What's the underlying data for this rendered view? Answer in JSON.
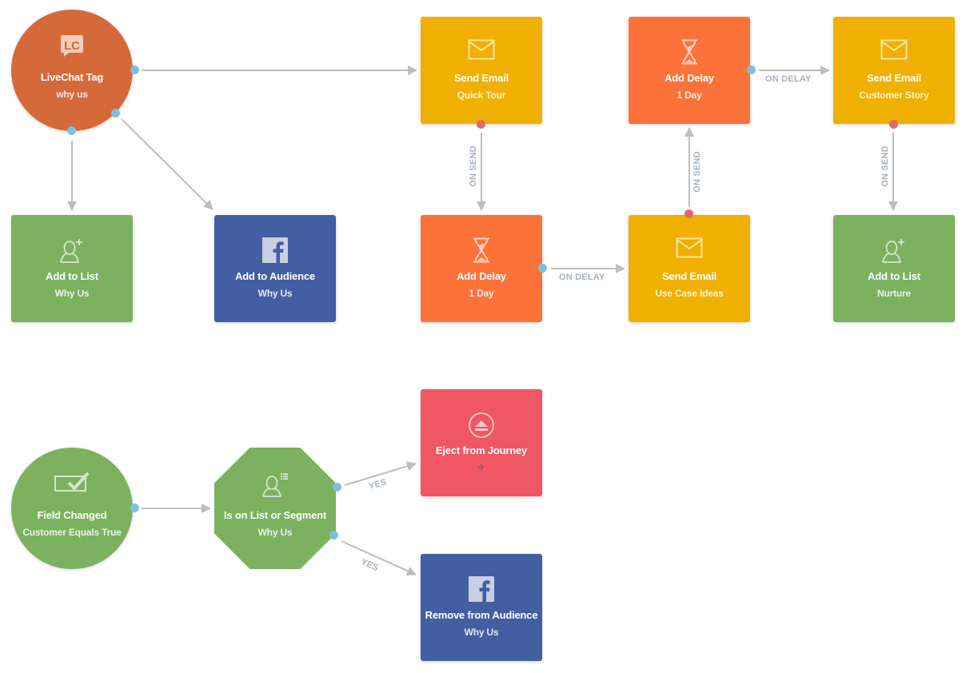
{
  "colors": {
    "livechat": "#d4693a",
    "email": "#f0b000",
    "delay": "#fd7238",
    "list": "#7bb15f",
    "facebook": "#435ea1",
    "eject": "#ef5862",
    "edge": "#bdbdbd",
    "edge_label": "#a7b1bf",
    "port_out": "#7ec0dc",
    "port_send": "#e06a6a"
  },
  "nodes": {
    "livechat_tag": {
      "title": "LiveChat Tag",
      "subtitle": "why us",
      "icon": "livechat-logo-icon"
    },
    "send_email_quick_tour": {
      "title": "Send Email",
      "subtitle": "Quick Tour",
      "icon": "envelope-icon"
    },
    "add_delay_top": {
      "title": "Add Delay",
      "subtitle": "1 Day",
      "icon": "hourglass-icon"
    },
    "send_email_customer_story": {
      "title": "Send Email",
      "subtitle": "Customer Story",
      "icon": "envelope-icon"
    },
    "add_to_list_why_us": {
      "title": "Add to List",
      "subtitle": "Why Us",
      "icon": "add-user-icon"
    },
    "add_to_audience_why_us": {
      "title": "Add to Audience",
      "subtitle": "Why Us",
      "icon": "facebook-icon"
    },
    "add_delay_bottom": {
      "title": "Add Delay",
      "subtitle": "1 Day",
      "icon": "hourglass-icon"
    },
    "send_email_use_case": {
      "title": "Send Email",
      "subtitle": "Use Case Ideas",
      "icon": "envelope-icon"
    },
    "add_to_list_nurture": {
      "title": "Add to List",
      "subtitle": "Nurture",
      "icon": "add-user-icon"
    },
    "field_changed": {
      "title": "Field Changed",
      "subtitle": "Customer Equals True",
      "icon": "checkbox-field-icon"
    },
    "is_on_list": {
      "title": "Is on List or Segment",
      "subtitle": "Why Us",
      "icon": "user-list-icon"
    },
    "eject_from_journey": {
      "title": "Eject from Journey",
      "subtitle": "✈",
      "icon": "eject-icon"
    },
    "remove_from_audience": {
      "title": "Remove from Audience",
      "subtitle": "Why Us",
      "icon": "facebook-icon"
    }
  },
  "edge_labels": {
    "on_send_1": "ON SEND",
    "on_delay_1": "ON DELAY",
    "on_send_2": "ON SEND",
    "on_delay_2": "ON DELAY",
    "on_send_3": "ON SEND",
    "yes_1": "YES",
    "yes_2": "YES"
  }
}
